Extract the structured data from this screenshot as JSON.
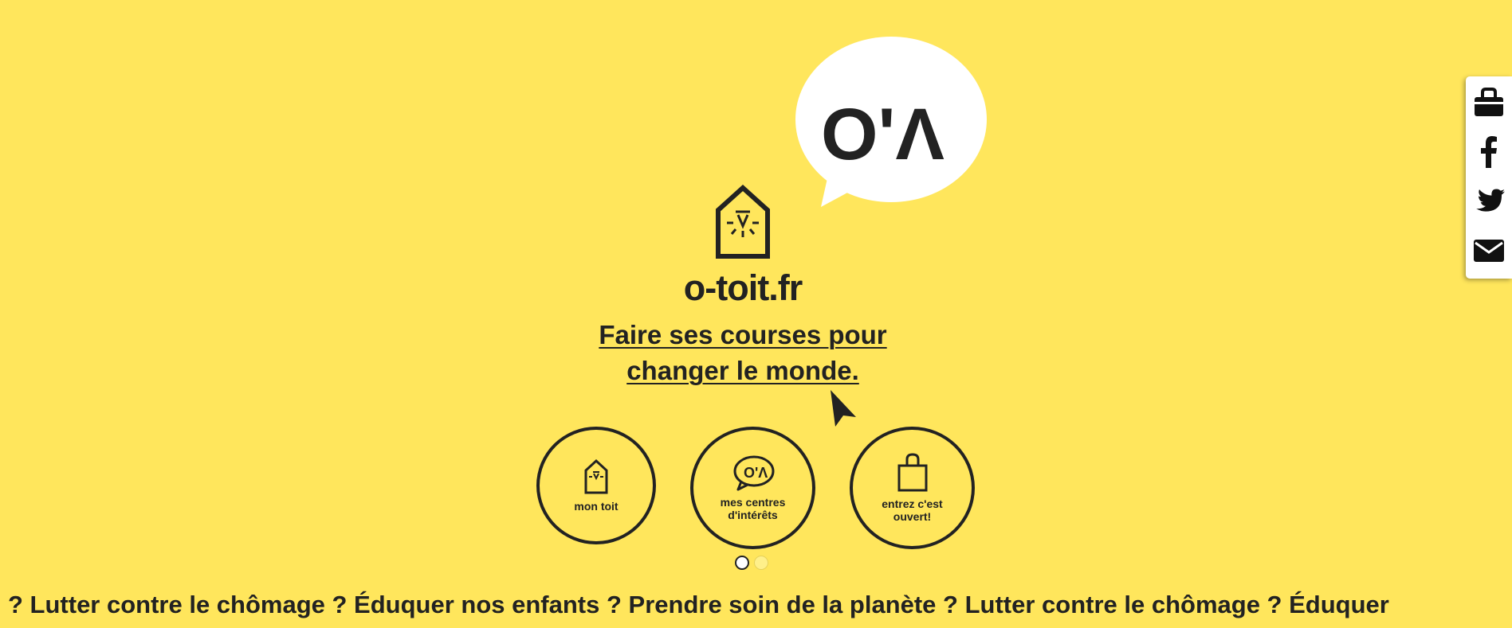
{
  "brand": {
    "name": "o-toit.fr",
    "tagline": "Faire ses courses pour changer le monde."
  },
  "bubble": {
    "text": "O'Λ"
  },
  "circles": [
    {
      "label": "mon toit",
      "icon": "house-icon"
    },
    {
      "label": "mes centres d'intérêts",
      "icon": "speech-bubble-icon"
    },
    {
      "label": "entrez c'est ouvert!",
      "icon": "shopping-bag-icon"
    }
  ],
  "carousel": {
    "dots": [
      {
        "active": true
      },
      {
        "active": false
      }
    ]
  },
  "ticker": {
    "text": "? Lutter contre le chômage ? Éduquer nos enfants ? Prendre soin de la planète ? Lutter contre le chômage ? Éduquer"
  },
  "social": {
    "items": [
      {
        "icon": "shopping-bag-icon"
      },
      {
        "icon": "facebook-icon"
      },
      {
        "icon": "twitter-icon"
      },
      {
        "icon": "envelope-icon"
      }
    ]
  },
  "colors": {
    "background": "#FFE65C",
    "ink": "#222222",
    "white": "#FFFFFF"
  }
}
